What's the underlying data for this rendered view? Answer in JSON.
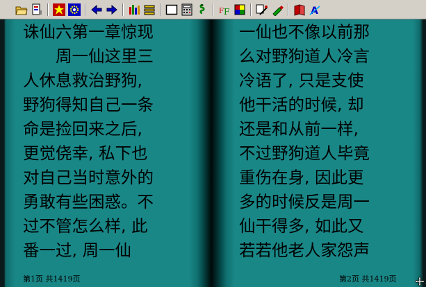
{
  "toolbar": {
    "icons": [
      "open-folder-icon",
      "bookmark-file-icon",
      "star-icon",
      "gear-icon",
      "arrow-left-icon",
      "arrow-right-icon",
      "color-bars-icon",
      "stack-icon",
      "window-icon",
      "calculator-icon",
      "snake-icon",
      "font-ff-icon",
      "grid-color-icon",
      "magic-icon",
      "brush-icon",
      "book-icon",
      "font-a-icon"
    ]
  },
  "left_page": {
    "lines": [
      "诛仙六第一章惊现",
      "　　周一仙这里三",
      "人休息救治野狗,",
      "野狗得知自己一条",
      "命是捡回来之后,",
      "更觉侥幸, 私下也",
      "对自己当时意外的",
      "勇敢有些困惑。不",
      "过不管怎么样, 此",
      "番一过, 周一仙"
    ],
    "footer": "第1页 共1419页"
  },
  "right_page": {
    "lines": [
      "一仙也不像以前那",
      "么对野狗道人冷言",
      "冷语了, 只是支使",
      "他干活的时候, 却",
      "还是和从前一样,",
      "不过野狗道人毕竟",
      "重伤在身, 因此更",
      "多的时候反是周一",
      "仙干得多, 如此又",
      "若若他老人家怨声"
    ],
    "footer": "第2页 共1419页"
  }
}
